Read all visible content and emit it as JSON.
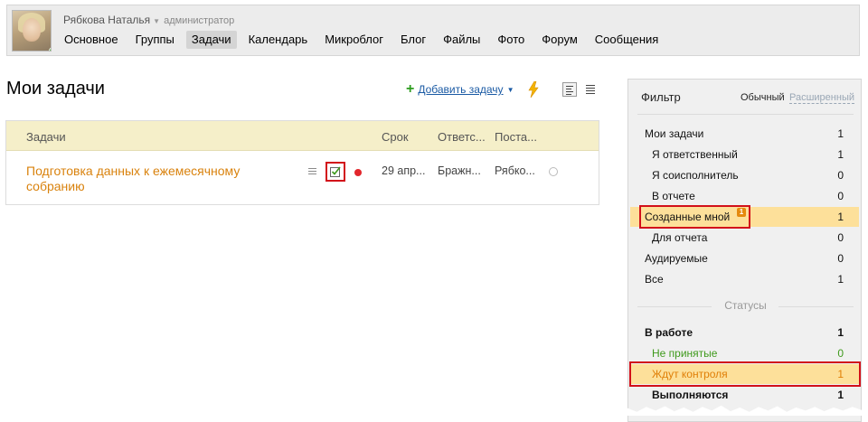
{
  "header": {
    "user_name": "Рябкова Наталья",
    "user_role": "администратор",
    "nav": [
      {
        "label": "Основное",
        "active": false
      },
      {
        "label": "Группы",
        "active": false
      },
      {
        "label": "Задачи",
        "active": true
      },
      {
        "label": "Календарь",
        "active": false
      },
      {
        "label": "Микроблог",
        "active": false
      },
      {
        "label": "Блог",
        "active": false
      },
      {
        "label": "Файлы",
        "active": false
      },
      {
        "label": "Фото",
        "active": false
      },
      {
        "label": "Форум",
        "active": false
      },
      {
        "label": "Сообщения",
        "active": false
      }
    ]
  },
  "main": {
    "title": "Мои задачи",
    "add_task_label": "Добавить задачу",
    "columns": {
      "task": "Задачи",
      "deadline": "Срок",
      "responsible": "Ответс...",
      "creator": "Поста..."
    },
    "tasks": [
      {
        "title": "Подготовка данных к ежемесячному собранию",
        "deadline": "29 апр...",
        "responsible": "Бражн...",
        "creator": "Рябко..."
      }
    ]
  },
  "filter": {
    "title": "Фильтр",
    "mode_simple": "Обычный",
    "mode_advanced": "Расширенный",
    "roles": [
      {
        "label": "Мои задачи",
        "count": "1"
      },
      {
        "label": "Я ответственный",
        "count": "1"
      },
      {
        "label": "Я соисполнитель",
        "count": "0"
      },
      {
        "label": "В отчете",
        "count": "0"
      },
      {
        "label": "Созданные мной",
        "count": "1",
        "badge": "1"
      },
      {
        "label": "Для отчета",
        "count": "0"
      },
      {
        "label": "Аудируемые",
        "count": "0"
      },
      {
        "label": "Все",
        "count": "1"
      }
    ],
    "statuses_heading": "Статусы",
    "statuses": [
      {
        "label": "В работе",
        "count": "1"
      },
      {
        "label": "Не принятые",
        "count": "0"
      },
      {
        "label": "Ждут контроля",
        "count": "1"
      },
      {
        "label": "Выполняются",
        "count": "1"
      }
    ]
  },
  "colors": {
    "task_link": "#d9820d",
    "highlight": "#fde09a",
    "annotation_red": "#d2101a",
    "table_header": "#f5efc9",
    "status_green": "#3f9a1c",
    "status_orange": "#e07f07"
  }
}
